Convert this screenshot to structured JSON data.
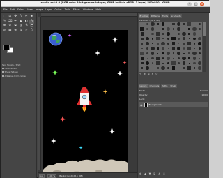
{
  "window": {
    "title": "apollo.xcf-2.0 [RGB color 8-bit gamma integer, GIMP built-in sRGB, 1 layer] 500x800 – GIMP"
  },
  "menu": [
    "File",
    "Edit",
    "Select",
    "View",
    "Image",
    "Layer",
    "Colors",
    "Tools",
    "Filters",
    "Windows",
    "Help"
  ],
  "toolbox": {
    "tools": [
      "⬚",
      "⊡",
      "✥",
      "⤡",
      "✂",
      "◈",
      "✎",
      "⌫",
      "✒",
      "▲",
      "◐",
      "A",
      "⊕",
      "⊘",
      "⧉",
      "◍",
      "⚗",
      "⬒",
      "⌀",
      "▦",
      "⊗",
      "↯",
      "☼",
      "⬯"
    ],
    "options": {
      "title": "Text Toggle / Shift",
      "items": [
        "Fixed width",
        "Show hidden",
        "Antialias from center"
      ]
    }
  },
  "status": {
    "unit": "px",
    "zoom": "100 %",
    "info": "Background (28.1 MB)"
  },
  "dock": {
    "tabs": [
      "Brushes",
      "Patterns",
      "Fonts",
      "Gradients"
    ],
    "brush_title": "Pencil 02 (50 × 50)",
    "layer_tabs": [
      "Layers",
      "Channels",
      "Paths",
      "Undo"
    ],
    "mode_label": "Mode",
    "mode_value": "Normal",
    "opacity_label": "Opacity",
    "opacity_value": "100.0",
    "lock_label": "Lock:",
    "layer_name": "Background"
  }
}
